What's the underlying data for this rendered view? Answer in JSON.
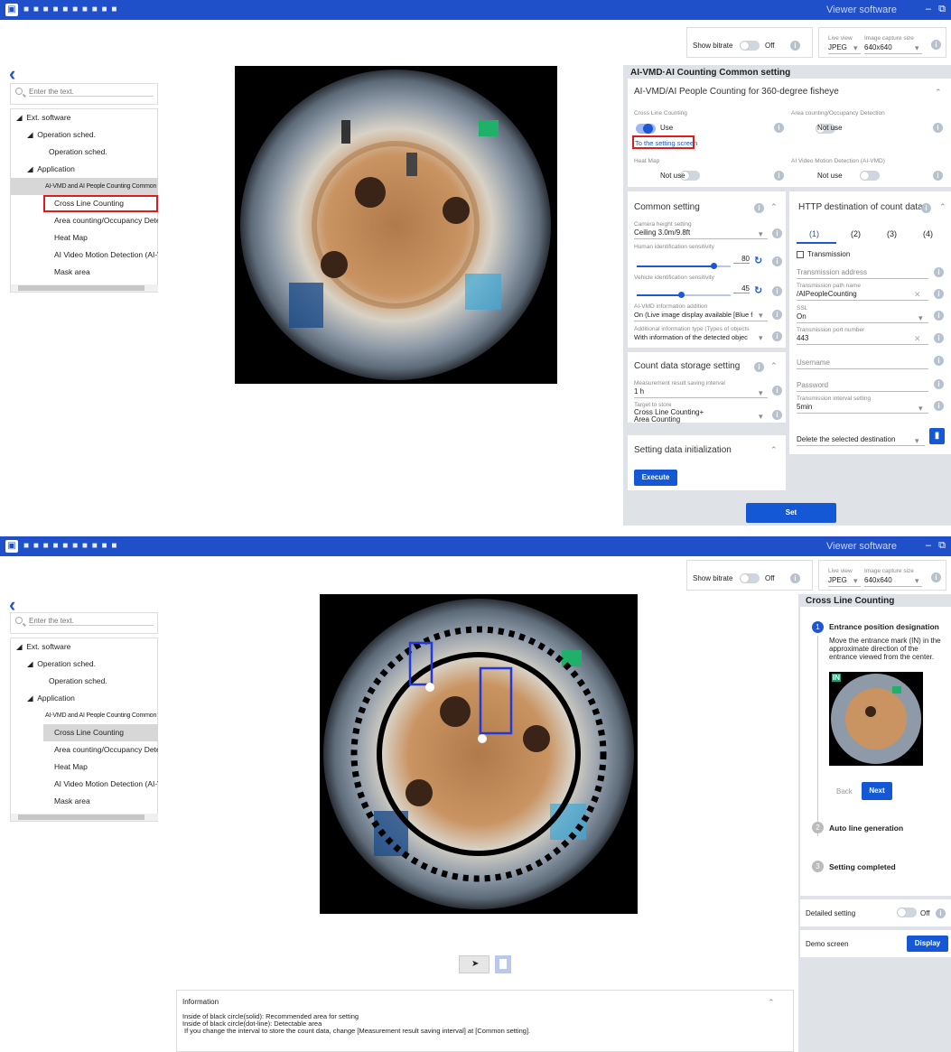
{
  "app": {
    "window_title": "■ ■ ■ ■ ■ ■ ■ ■ ■ ■",
    "name": "Viewer software",
    "min_glyph": "–",
    "restore_glyph": "⧉"
  },
  "top_controls": {
    "show_bitrate_label": "Show bitrate",
    "bitrate_state": "Off",
    "live_view_label": "Live view",
    "live_view_value": "JPEG",
    "capture_size_label": "Image capture size",
    "capture_size_value": "640x640"
  },
  "sidebar": {
    "search_placeholder": "Enter the text.",
    "items": [
      {
        "label": "Ext. software"
      },
      {
        "label": "Operation sched."
      },
      {
        "label": "Operation sched."
      },
      {
        "label": "Application"
      },
      {
        "label": "AI-VMD and AI People Counting  Common"
      },
      {
        "label": "Cross Line Counting"
      },
      {
        "label": "Area counting/Occupancy Detecti"
      },
      {
        "label": "Heat Map"
      },
      {
        "label": "AI Video Motion Detection (AI-VN"
      },
      {
        "label": "Mask area"
      }
    ]
  },
  "screen1": {
    "panel_title": "AI-VMD·AI Counting Common setting",
    "section_title": "AI-VMD/AI People Counting for 360-degree fisheye",
    "cross_line_label": "Cross Line Counting",
    "cross_line_value": "Use",
    "setting_link": "To the setting screen",
    "area_label": "Area counting/Occupancy Detection",
    "area_value": "Not use",
    "heatmap_label": "Heat Map",
    "heatmap_value": "Not use",
    "aivmd_label": "AI Video Motion Detection (AI-VMD)",
    "aivmd_value": "Not use",
    "common": {
      "title": "Common setting",
      "camera_height_label": "Camera height setting",
      "camera_height_value": "Ceiling 3.0m/9.8ft",
      "human_label": "Human identification sensitivity",
      "human_value": "80",
      "vehicle_label": "Vehicle identification sensitivity",
      "vehicle_value": "45",
      "info_add_label": "AI-VMD information addition",
      "info_add_value": "On (Live image display available [Blue f",
      "add_type_label": "Additional information type (Types of objects",
      "add_type_value": "With information of the detected objec"
    },
    "storage": {
      "title": "Count data storage setting",
      "interval_label": "Measurement result saving interval",
      "interval_value": "1 h",
      "target_label": "Target to store",
      "target_value_1": "Cross Line Counting+",
      "target_value_2": "Area Counting"
    },
    "init": {
      "title": "Setting data initialization",
      "execute": "Execute"
    },
    "http": {
      "title": "HTTP destination of count data",
      "tabs": [
        "(1)",
        "(2)",
        "(3)",
        "(4)"
      ],
      "transmission_label": "Transmission",
      "address_label": "Transmission address",
      "path_label": "Transmission path name",
      "path_value": "/AIPeopleCounting",
      "ssl_label": "SSL",
      "ssl_value": "On",
      "port_label": "Transmission port number",
      "port_value": "443",
      "username_label": "Username",
      "password_label": "Password",
      "interval_label": "Transmission interval setting",
      "interval_value": "5min",
      "delete_label": "Delete the selected destination"
    },
    "set_button": "Set"
  },
  "screen2": {
    "panel_title": "Cross Line Counting",
    "step1_num": "1",
    "step1_title": "Entrance position designation",
    "step1_desc": "Move the entrance mark (IN) in the approximate direction of the entrance viewed from the center.",
    "in_mark": "IN",
    "back": "Back",
    "next": "Next",
    "step2_num": "2",
    "step2_title": "Auto line generation",
    "step3_num": "3",
    "step3_title": "Setting completed",
    "detailed_label": "Detailed setting",
    "detailed_state": "Off",
    "demo_label": "Demo screen",
    "display_button": "Display",
    "info_title": "Information",
    "info_line1": "Inside of black circle(solid): Recommended area for setting",
    "info_line2": "Inside of black circle(dot-line): Detectable area",
    "info_line3": "If you change the interval to store the count data, change [Measurement result saving interval] at [Common setting]."
  },
  "colors": {
    "titlebar": "#1f4fc9",
    "accent": "#1558d6",
    "highlight": "#e01b1b",
    "panel_bg": "#dfe3e8"
  }
}
